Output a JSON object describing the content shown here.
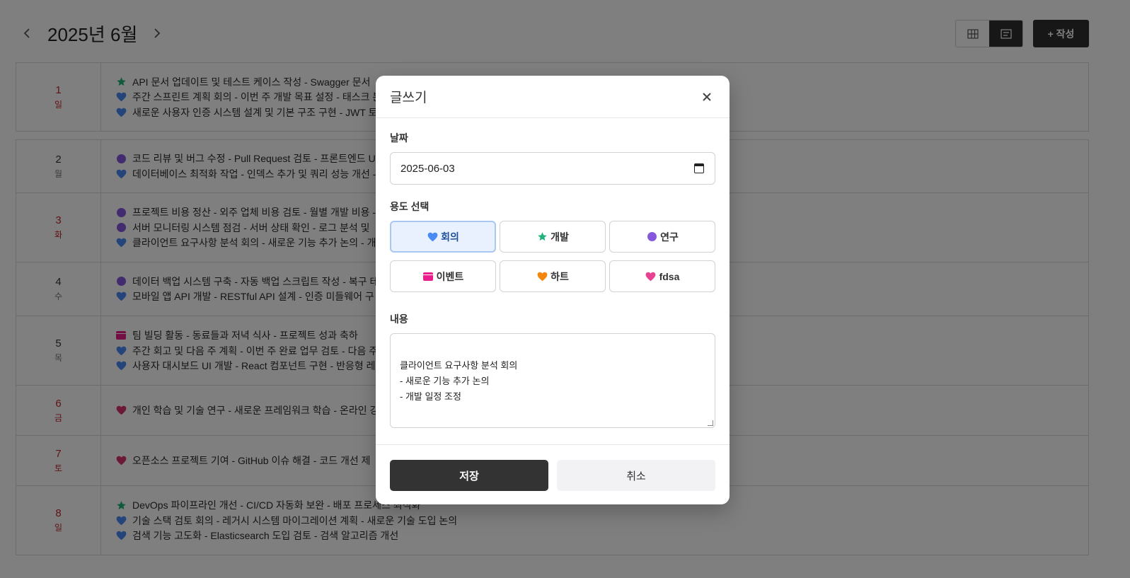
{
  "header": {
    "prev_icon": "chevron-left-icon",
    "month_title": "2025년 6월",
    "next_icon": "chevron-right-icon",
    "view_grid_icon": "grid-icon",
    "view_list_icon": "list-icon",
    "write_label": "+ 작성"
  },
  "colors": {
    "meeting": "#4a8af4",
    "dev": "#1fb37a",
    "research": "#8557dd",
    "event": "#e91e8c",
    "heart_orange": "#f5850b",
    "heart_pink": "#e84393",
    "weekend": "#c0262b"
  },
  "days": [
    {
      "num": "1",
      "weekday": "일",
      "red": true,
      "events": [
        {
          "type": "dev",
          "text": "API 문서 업데이트 및 테스트 케이스 작성 - Swagger 문서"
        },
        {
          "type": "meeting",
          "text": "주간 스프린트 계획 회의 - 이번 주 개발 목표 설정 - 태스크 분"
        },
        {
          "type": "meeting",
          "text": "새로운 사용자 인증 시스템 설계 및 기본 구조 구현 - JWT 토"
        }
      ]
    },
    {
      "num": "2",
      "weekday": "월",
      "red": false,
      "events": [
        {
          "type": "research",
          "text": "코드 리뷰 및 버그 수정 - Pull Request 검토 - 프론트엔드 U"
        },
        {
          "type": "meeting",
          "text": "데이터베이스 최적화 작업 - 인덱스 추가 및 쿼리 성능 개선 -"
        }
      ]
    },
    {
      "num": "3",
      "weekday": "화",
      "red": true,
      "events": [
        {
          "type": "research",
          "text": "프로젝트 비용 정산 - 외주 업체 비용 검토 - 월별 개발 비용 -"
        },
        {
          "type": "research",
          "text": "서버 모니터링 시스템 점검 - 서버 상태 확인 - 로그 분석 및"
        },
        {
          "type": "meeting",
          "text": "클라이언트 요구사항 분석 회의 - 새로운 기능 추가 논의 - 개"
        }
      ]
    },
    {
      "num": "4",
      "weekday": "수",
      "red": false,
      "events": [
        {
          "type": "research",
          "text": "데이터 백업 시스템 구축 - 자동 백업 스크립트 작성 - 복구 테"
        },
        {
          "type": "meeting",
          "text": "모바일 앱 API 개발 - RESTful API 설계 - 인증 미들웨어 구"
        }
      ]
    },
    {
      "num": "5",
      "weekday": "목",
      "red": false,
      "events": [
        {
          "type": "event",
          "text": "팀 빌딩 활동 - 동료들과 저녁 식사 - 프로젝트 성과 축하"
        },
        {
          "type": "meeting",
          "text": "주간 회고 및 다음 주 계획 - 이번 주 완료 업무 검토 - 다음 주"
        },
        {
          "type": "meeting",
          "text": "사용자 대시보드 UI 개발 - React 컴포넌트 구현 - 반응형 레"
        }
      ]
    },
    {
      "num": "6",
      "weekday": "금",
      "red": true,
      "events": [
        {
          "type": "heart",
          "text": "개인 학습 및 기술 연구 - 새로운 프레임워크 학습 - 온라인 강"
        }
      ]
    },
    {
      "num": "7",
      "weekday": "토",
      "red": true,
      "events": [
        {
          "type": "heart",
          "text": "오픈소스 프로젝트 기여 - GitHub 이슈 해결 - 코드 개선 제"
        }
      ]
    },
    {
      "num": "8",
      "weekday": "일",
      "red": true,
      "events": [
        {
          "type": "dev",
          "text": "DevOps 파이프라인 개선 - CI/CD 자동화 보완 - 배포 프로세스 최적화"
        },
        {
          "type": "meeting",
          "text": "기술 스택 검토 회의 - 레거시 시스템 마이그레이션 계획 - 새로운 기술 도입 논의"
        },
        {
          "type": "meeting",
          "text": "검색 기능 고도화 - Elasticsearch 도입 검토 - 검색 알고리즘 개선"
        }
      ]
    }
  ],
  "modal": {
    "title": "글쓰기",
    "close_icon": "close-icon",
    "date_label": "날짜",
    "date_value": "2025-06-03",
    "purpose_label": "용도 선택",
    "purposes": [
      {
        "label": "회의",
        "icon": "blue-heart-icon",
        "selected": true
      },
      {
        "label": "개발",
        "icon": "green-star-icon",
        "selected": false
      },
      {
        "label": "연구",
        "icon": "purple-circle-icon",
        "selected": false
      },
      {
        "label": "이벤트",
        "icon": "calendar-icon",
        "selected": false
      },
      {
        "label": "하트",
        "icon": "orange-heart-icon",
        "selected": false
      },
      {
        "label": "fdsa",
        "icon": "pink-heart-icon",
        "selected": false
      }
    ],
    "content_label": "내용",
    "content_value": "클라이언트 요구사항 분석 회의\n- 새로운 기능 추가 논의\n- 개발 일정 조정",
    "save_label": "저장",
    "cancel_label": "취소"
  }
}
